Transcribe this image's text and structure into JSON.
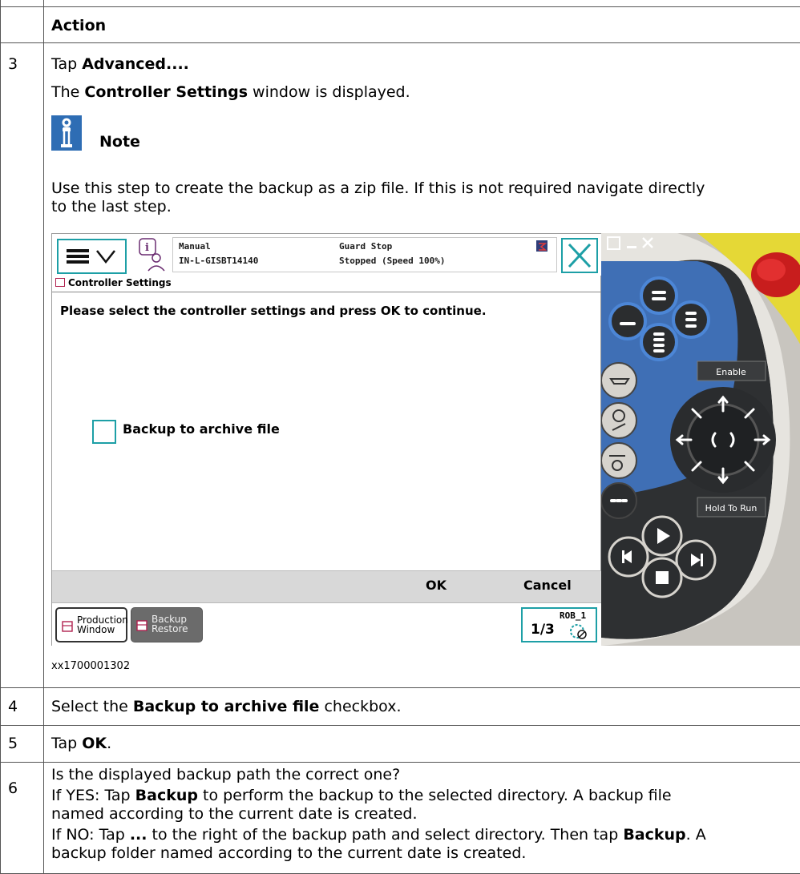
{
  "table": {
    "header": "Action",
    "rows": [
      {
        "number": "3",
        "line1_pre": "Tap ",
        "line1_bold": "Advanced...",
        "line1_post": ".",
        "line2_pre": "The ",
        "line2_bold": "Controller Settings",
        "line2_post": " window is displayed.",
        "note_label": "Note",
        "note_line1": "Use this step to create the backup as a zip file. If this is not required navigate directly",
        "note_line2": "to the last step.",
        "caption": "xx1700001302"
      },
      {
        "number": "4",
        "pre": "Select the ",
        "bold": "Backup to archive file",
        "post": " checkbox."
      },
      {
        "number": "5",
        "pre": "Tap ",
        "bold": "OK",
        "post": "."
      },
      {
        "number": "6",
        "line1": "Is the displayed backup path the correct one?",
        "line2_pre": "If YES: Tap ",
        "line2_bold": "Backup",
        "line2_post": " to perform the backup to the selected directory. A backup file",
        "line3": "named according to the current date is created.",
        "line4_pre": "If NO: Tap ",
        "line4_bold": "...",
        "line4_mid": " to the right of the backup path and select directory. Then tap ",
        "line4_bold2": "Backup",
        "line4_post": ". A",
        "line5": "backup folder named according to the current date is created."
      }
    ]
  },
  "flexpendant": {
    "status": {
      "mode": "Manual",
      "controller": "IN-L-GISBT14140",
      "state": "Guard Stop",
      "speed": "Stopped (Speed 100%)"
    },
    "breadcrumb": "Controller Settings",
    "prompt": "Please select the controller settings and  press OK to continue.",
    "checkbox_label": "Backup to archive file",
    "ok_label": "OK",
    "cancel_label": "Cancel",
    "tasks": [
      {
        "label": "Production\nWindow",
        "icon": "window-icon"
      },
      {
        "label": "Backup\nRestore",
        "icon": "backup-icon"
      }
    ],
    "rob_label": "ROB_1",
    "rob_fraction": "1/3",
    "device": {
      "enable_label": "Enable",
      "hold_label": "Hold To Run"
    }
  }
}
